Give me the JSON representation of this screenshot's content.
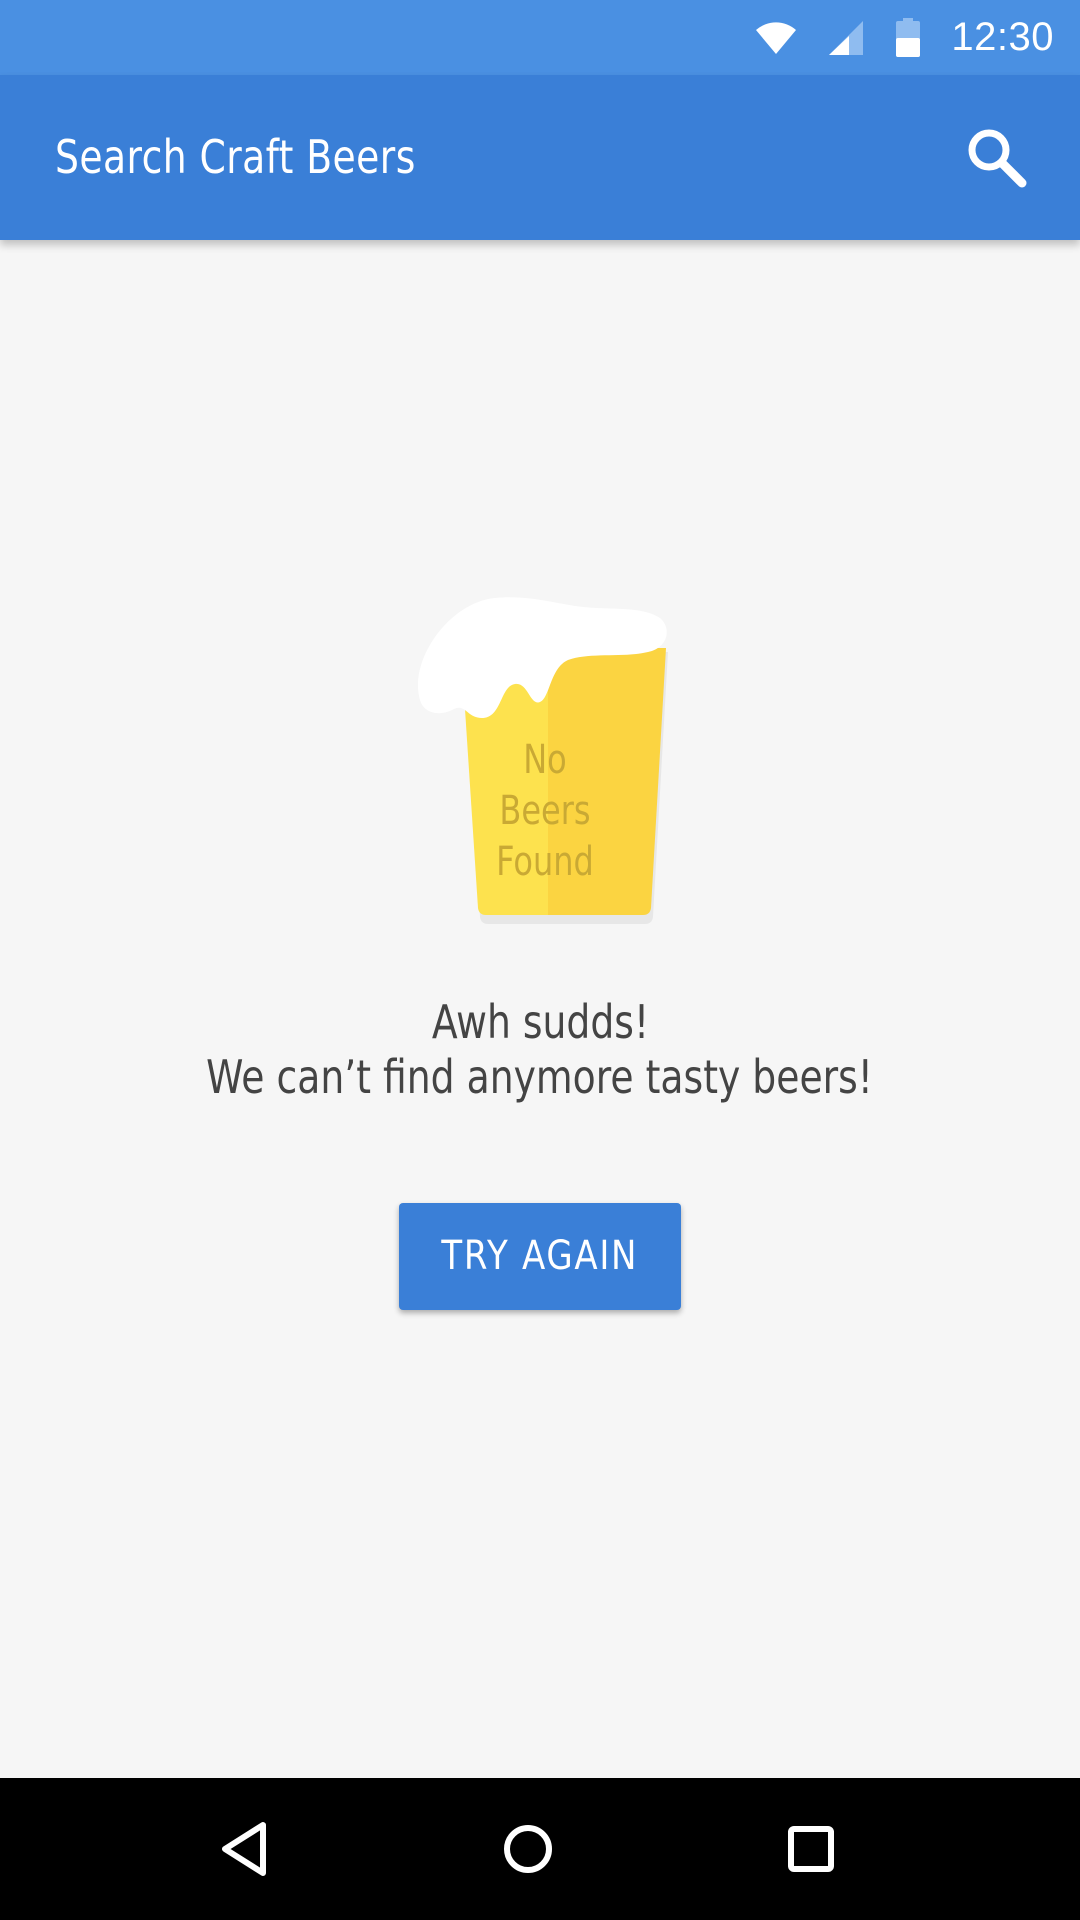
{
  "status_bar": {
    "time": "12:30",
    "icons": [
      "wifi-icon",
      "cellular-signal-icon",
      "battery-icon"
    ]
  },
  "app_bar": {
    "title": "Search Craft Beers",
    "action_icon": "search-icon"
  },
  "empty_state": {
    "illustration": "beer-glass-icon",
    "glass_label_lines": [
      "No",
      "Beers",
      "Found"
    ],
    "heading": "Awh sudds!",
    "subheading": "We can’t find anymore tasty beers!",
    "button_label": "TRY AGAIN"
  },
  "nav_bar": {
    "icons": [
      "back-icon",
      "home-icon",
      "recents-icon"
    ]
  },
  "colors": {
    "status_bar": "#4a90e2",
    "app_bar": "#3a7fd7",
    "background": "#f6f6f6",
    "beer_light": "#fde24e",
    "beer_dark": "#fbd441",
    "foam": "#ffffff",
    "text": "#444444"
  }
}
